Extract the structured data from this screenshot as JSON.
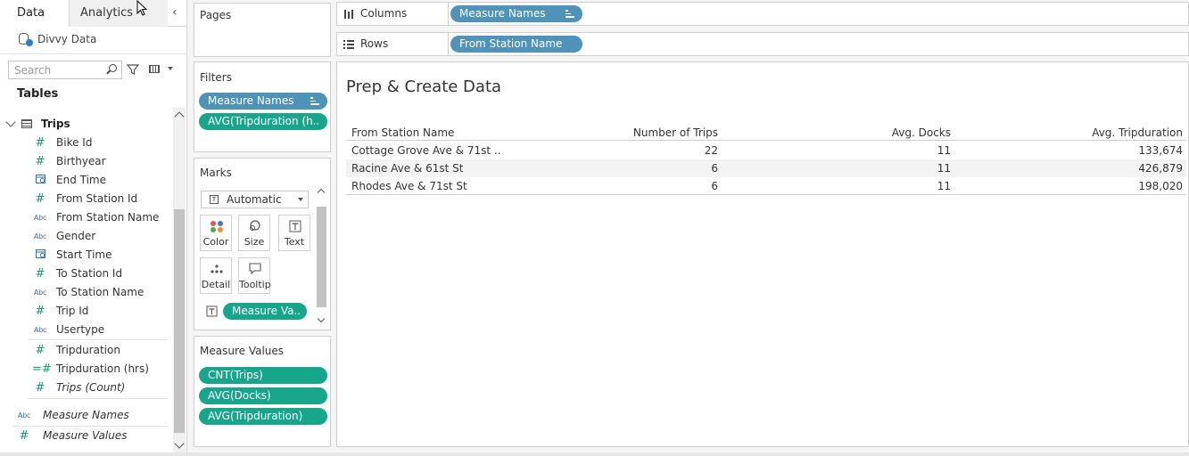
{
  "tabs": {
    "data": "Data",
    "analytics": "Analytics"
  },
  "datasource": "Divvy Data",
  "search": {
    "placeholder": "Search"
  },
  "tables_heading": "Tables",
  "table_name": "Trips",
  "fields": [
    {
      "label": "Bike Id",
      "type": "hash"
    },
    {
      "label": "Birthyear",
      "type": "hash"
    },
    {
      "label": "End Time",
      "type": "calendar"
    },
    {
      "label": "From Station Id",
      "type": "hash"
    },
    {
      "label": "From Station Name",
      "type": "abc"
    },
    {
      "label": "Gender",
      "type": "abc"
    },
    {
      "label": "Start Time",
      "type": "calendar"
    },
    {
      "label": "To Station Id",
      "type": "hash"
    },
    {
      "label": "To Station Name",
      "type": "abc"
    },
    {
      "label": "Trip Id",
      "type": "hash"
    },
    {
      "label": "Usertype",
      "type": "abc"
    }
  ],
  "measures": [
    {
      "label": "Tripduration",
      "type": "hash"
    },
    {
      "label": "Tripduration (hrs)",
      "type": "calc-hash"
    },
    {
      "label": "Trips (Count)",
      "type": "hash"
    }
  ],
  "extra_fields": [
    {
      "label": "Measure Names",
      "type": "abc"
    },
    {
      "label": "Measure Values",
      "type": "hash"
    }
  ],
  "cards": {
    "pages": "Pages",
    "filters": "Filters",
    "marks": "Marks",
    "measure_values": "Measure Values"
  },
  "filters": [
    "Measure Names",
    "AVG(Tripduration (h.."
  ],
  "marks": {
    "type": "Automatic",
    "buttons": [
      "Color",
      "Size",
      "Text",
      "Detail",
      "Tooltip"
    ],
    "text_pill": "Measure Va.."
  },
  "measure_values": [
    "CNT(Trips)",
    "AVG(Docks)",
    "AVG(Tripduration)"
  ],
  "shelves": {
    "columns_label": "Columns",
    "columns_pill": "Measure Names",
    "rows_label": "Rows",
    "rows_pill": "From Station Name"
  },
  "view": {
    "title": "Prep & Create Data",
    "headers": [
      "From Station Name",
      "Number of Trips",
      "Avg. Docks",
      "Avg. Tripduration"
    ],
    "rows": [
      [
        "Cottage Grove Ave & 71st ..",
        "22",
        "11",
        "133,674"
      ],
      [
        "Racine Ave & 61st St",
        "6",
        "11",
        "426,879"
      ],
      [
        "Rhodes Ave & 71st St",
        "6",
        "11",
        "198,020"
      ]
    ]
  }
}
